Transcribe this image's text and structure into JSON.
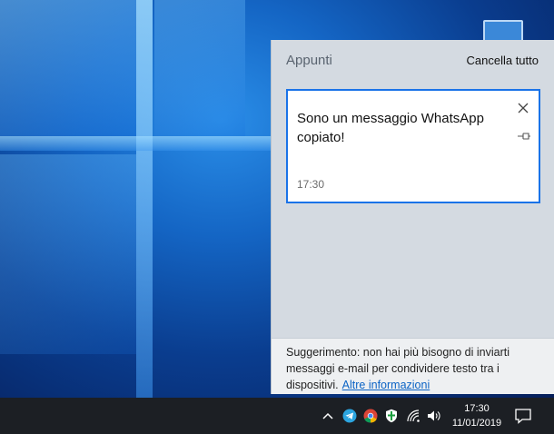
{
  "clipboard": {
    "title": "Appunti",
    "clear_all_label": "Cancella tutto",
    "items": [
      {
        "text": "Sono un messaggio WhatsApp copiato!",
        "time": "17:30"
      }
    ],
    "tip_text": "Suggerimento: non hai più bisogno di inviarti messaggi e-mail per condividere testo tra i dispositivi.",
    "tip_link": "Altre informazioni"
  },
  "taskbar": {
    "time": "17:30",
    "date": "11/01/2019",
    "tray_icons": [
      "chevron-up-icon",
      "telegram-icon",
      "chrome-icon",
      "shield-icon",
      "wifi-icon",
      "volume-icon",
      "notification-icon"
    ]
  },
  "colors": {
    "accent": "#1a73e8",
    "link": "#0b63c5",
    "taskbar": "#1c1f24",
    "panel": "#d4dae1"
  }
}
